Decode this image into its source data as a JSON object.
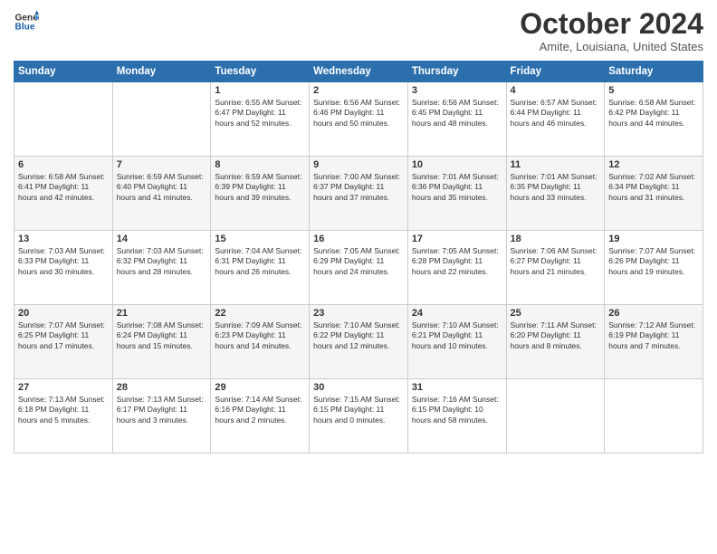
{
  "header": {
    "logo_line1": "General",
    "logo_line2": "Blue",
    "month": "October 2024",
    "location": "Amite, Louisiana, United States"
  },
  "days_of_week": [
    "Sunday",
    "Monday",
    "Tuesday",
    "Wednesday",
    "Thursday",
    "Friday",
    "Saturday"
  ],
  "weeks": [
    [
      {
        "day": "",
        "text": ""
      },
      {
        "day": "",
        "text": ""
      },
      {
        "day": "1",
        "text": "Sunrise: 6:55 AM\nSunset: 6:47 PM\nDaylight: 11 hours and 52 minutes."
      },
      {
        "day": "2",
        "text": "Sunrise: 6:56 AM\nSunset: 6:46 PM\nDaylight: 11 hours and 50 minutes."
      },
      {
        "day": "3",
        "text": "Sunrise: 6:56 AM\nSunset: 6:45 PM\nDaylight: 11 hours and 48 minutes."
      },
      {
        "day": "4",
        "text": "Sunrise: 6:57 AM\nSunset: 6:44 PM\nDaylight: 11 hours and 46 minutes."
      },
      {
        "day": "5",
        "text": "Sunrise: 6:58 AM\nSunset: 6:42 PM\nDaylight: 11 hours and 44 minutes."
      }
    ],
    [
      {
        "day": "6",
        "text": "Sunrise: 6:58 AM\nSunset: 6:41 PM\nDaylight: 11 hours and 42 minutes."
      },
      {
        "day": "7",
        "text": "Sunrise: 6:59 AM\nSunset: 6:40 PM\nDaylight: 11 hours and 41 minutes."
      },
      {
        "day": "8",
        "text": "Sunrise: 6:59 AM\nSunset: 6:39 PM\nDaylight: 11 hours and 39 minutes."
      },
      {
        "day": "9",
        "text": "Sunrise: 7:00 AM\nSunset: 6:37 PM\nDaylight: 11 hours and 37 minutes."
      },
      {
        "day": "10",
        "text": "Sunrise: 7:01 AM\nSunset: 6:36 PM\nDaylight: 11 hours and 35 minutes."
      },
      {
        "day": "11",
        "text": "Sunrise: 7:01 AM\nSunset: 6:35 PM\nDaylight: 11 hours and 33 minutes."
      },
      {
        "day": "12",
        "text": "Sunrise: 7:02 AM\nSunset: 6:34 PM\nDaylight: 11 hours and 31 minutes."
      }
    ],
    [
      {
        "day": "13",
        "text": "Sunrise: 7:03 AM\nSunset: 6:33 PM\nDaylight: 11 hours and 30 minutes."
      },
      {
        "day": "14",
        "text": "Sunrise: 7:03 AM\nSunset: 6:32 PM\nDaylight: 11 hours and 28 minutes."
      },
      {
        "day": "15",
        "text": "Sunrise: 7:04 AM\nSunset: 6:31 PM\nDaylight: 11 hours and 26 minutes."
      },
      {
        "day": "16",
        "text": "Sunrise: 7:05 AM\nSunset: 6:29 PM\nDaylight: 11 hours and 24 minutes."
      },
      {
        "day": "17",
        "text": "Sunrise: 7:05 AM\nSunset: 6:28 PM\nDaylight: 11 hours and 22 minutes."
      },
      {
        "day": "18",
        "text": "Sunrise: 7:06 AM\nSunset: 6:27 PM\nDaylight: 11 hours and 21 minutes."
      },
      {
        "day": "19",
        "text": "Sunrise: 7:07 AM\nSunset: 6:26 PM\nDaylight: 11 hours and 19 minutes."
      }
    ],
    [
      {
        "day": "20",
        "text": "Sunrise: 7:07 AM\nSunset: 6:25 PM\nDaylight: 11 hours and 17 minutes."
      },
      {
        "day": "21",
        "text": "Sunrise: 7:08 AM\nSunset: 6:24 PM\nDaylight: 11 hours and 15 minutes."
      },
      {
        "day": "22",
        "text": "Sunrise: 7:09 AM\nSunset: 6:23 PM\nDaylight: 11 hours and 14 minutes."
      },
      {
        "day": "23",
        "text": "Sunrise: 7:10 AM\nSunset: 6:22 PM\nDaylight: 11 hours and 12 minutes."
      },
      {
        "day": "24",
        "text": "Sunrise: 7:10 AM\nSunset: 6:21 PM\nDaylight: 11 hours and 10 minutes."
      },
      {
        "day": "25",
        "text": "Sunrise: 7:11 AM\nSunset: 6:20 PM\nDaylight: 11 hours and 8 minutes."
      },
      {
        "day": "26",
        "text": "Sunrise: 7:12 AM\nSunset: 6:19 PM\nDaylight: 11 hours and 7 minutes."
      }
    ],
    [
      {
        "day": "27",
        "text": "Sunrise: 7:13 AM\nSunset: 6:18 PM\nDaylight: 11 hours and 5 minutes."
      },
      {
        "day": "28",
        "text": "Sunrise: 7:13 AM\nSunset: 6:17 PM\nDaylight: 11 hours and 3 minutes."
      },
      {
        "day": "29",
        "text": "Sunrise: 7:14 AM\nSunset: 6:16 PM\nDaylight: 11 hours and 2 minutes."
      },
      {
        "day": "30",
        "text": "Sunrise: 7:15 AM\nSunset: 6:15 PM\nDaylight: 11 hours and 0 minutes."
      },
      {
        "day": "31",
        "text": "Sunrise: 7:16 AM\nSunset: 6:15 PM\nDaylight: 10 hours and 58 minutes."
      },
      {
        "day": "",
        "text": ""
      },
      {
        "day": "",
        "text": ""
      }
    ]
  ]
}
